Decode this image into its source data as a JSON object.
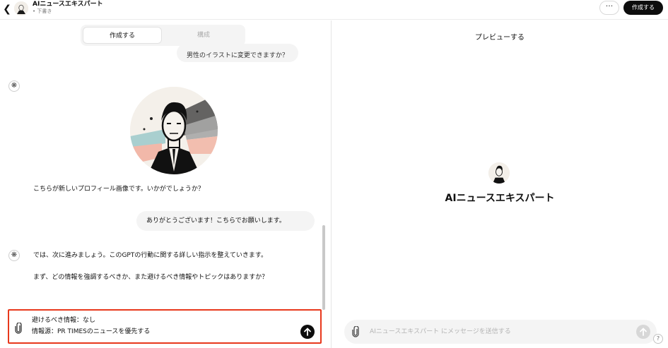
{
  "header": {
    "back_icon": "chevron-left-icon",
    "gpt_name": "AIニュースエキスパート",
    "status": "• 下書き",
    "more_label": "···",
    "create_label": "作成する"
  },
  "tabs": [
    {
      "label": "作成する",
      "active": true
    },
    {
      "label": "構成",
      "active": false
    }
  ],
  "chat": {
    "user_msg_partial": "男性のイラストに変更できますか？",
    "assistant_profile_msg": "こちらが新しいプロフィール画像です。いかがでしょうか？",
    "user_thanks": "ありがとうございます！こちらでお願いします。",
    "assistant_next_1": "では、次に進みましょう。このGPTの行動に関する詳しい指示を整えていきます。",
    "assistant_next_2": "まず、どの情報を強調するべきか、また避けるべき情報やトピックはありますか？",
    "assistant_icon": "openai-logo-icon"
  },
  "composer": {
    "line1": "避けるべき情報：なし",
    "line2": "情報源：PR TIMESのニュースを優先する",
    "attach_icon": "paperclip-icon",
    "send_icon": "arrow-up-icon",
    "highlight_color": "#e8381c"
  },
  "preview": {
    "title": "プレビューする",
    "gpt_name": "AIニュースエキスパート",
    "placeholder": "AIニュースエキスパート にメッセージを送信する",
    "attach_icon": "paperclip-icon",
    "send_icon": "arrow-up-icon",
    "help_label": "?"
  }
}
